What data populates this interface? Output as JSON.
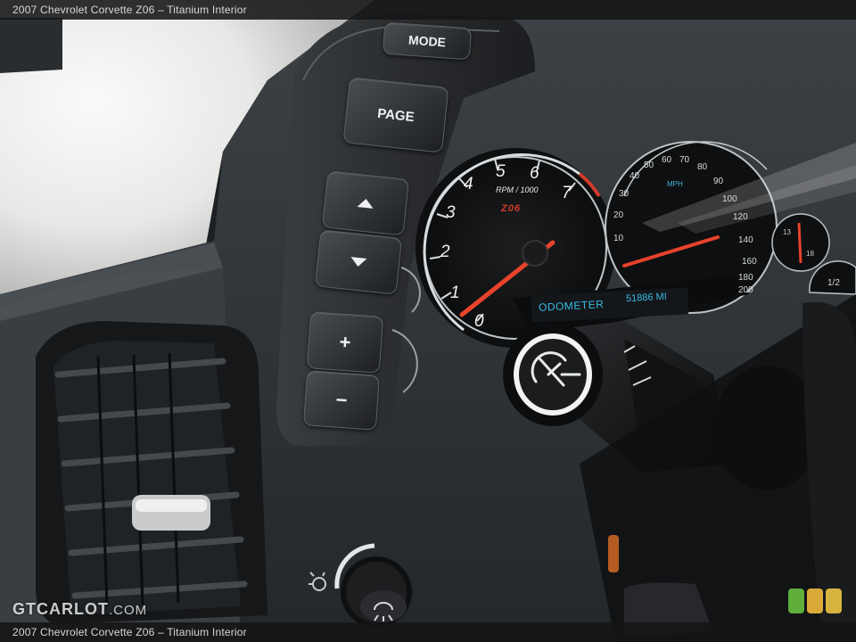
{
  "caption": "2007 Chevrolet Corvette Z06 – Titanium Interior",
  "watermark": {
    "brand": "GTCARLOT",
    "domain": ".COM"
  },
  "controls": {
    "mode_label": "MODE",
    "page_label": "PAGE",
    "plus_label": "+",
    "minus_label": "−"
  },
  "tachometer": {
    "numbers": [
      "0",
      "1",
      "2",
      "3",
      "4",
      "5",
      "6",
      "7"
    ],
    "unit": "RPM / 1000",
    "badge": "Z06"
  },
  "speedometer": {
    "numbers": [
      "10",
      "20",
      "30",
      "40",
      "50",
      "60",
      "70",
      "80",
      "90",
      "100",
      "120",
      "140",
      "160",
      "180",
      "200"
    ],
    "unit": "MPH"
  },
  "odometer": {
    "label": "ODOMETER",
    "value": "51886 MI"
  },
  "small_gauges": {
    "fuel_label": "1/2",
    "temp_low": "13",
    "temp_high": "18"
  },
  "rating_colors": [
    "#5fae3c",
    "#d9a93a",
    "#d6b33e"
  ]
}
